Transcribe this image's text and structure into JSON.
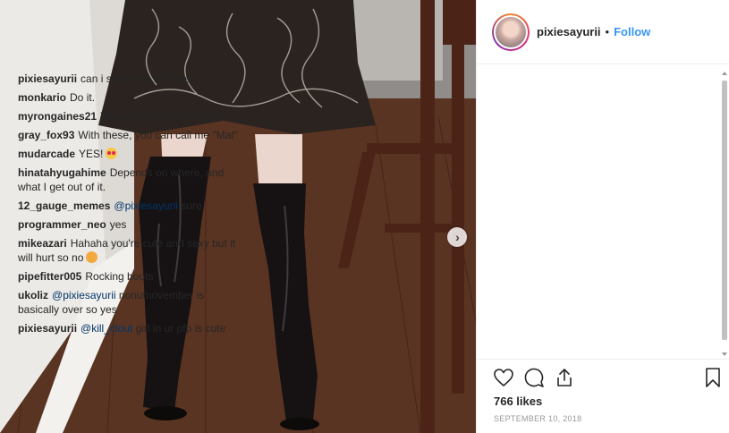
{
  "post": {
    "username": "pixiesayurii",
    "separator": "•",
    "follow_label": "Follow",
    "likes": "766 likes",
    "date": "SEPTEMBER 10, 2018"
  },
  "comments": [
    {
      "user": "pixiesayurii",
      "text": "can i step on u with these"
    },
    {
      "user": "monkario",
      "text": "Do it."
    },
    {
      "user": "myrongaines21",
      "text": "Yaaaas hentai mommy plz"
    },
    {
      "user": "gray_fox93",
      "text": "With these, you can call me \"Mat\""
    },
    {
      "user": "mudarcade",
      "text": "YES!"
    },
    {
      "user": "hinatahyugahime",
      "text": "Depends on where, and what I get out of it."
    },
    {
      "user": "12_gauge_memes",
      "mention": "@pixiesayurii",
      "text": "sure"
    },
    {
      "user": "programmer_neo",
      "text": "yes"
    },
    {
      "user": "mikeazari",
      "text": "Hahaha you're cute and sexy but it will hurt so no"
    },
    {
      "user": "pipefitter005",
      "text": "Rocking boots"
    },
    {
      "user": "ukoliz",
      "mention": "@pixiesayurii",
      "text": "nonutnovember is basically over so yes"
    },
    {
      "user": "pixiesayurii",
      "mention": "@kill_clout",
      "text": "girl in ur pfp is cute"
    }
  ],
  "icons": {
    "like": "heart-icon",
    "comment": "comment-icon",
    "share": "share-icon",
    "save": "bookmark-icon",
    "next": "chevron-right-icon"
  },
  "colors": {
    "accent": "#3897f0",
    "mention": "#003569",
    "text": "#262626",
    "muted": "#999999"
  }
}
